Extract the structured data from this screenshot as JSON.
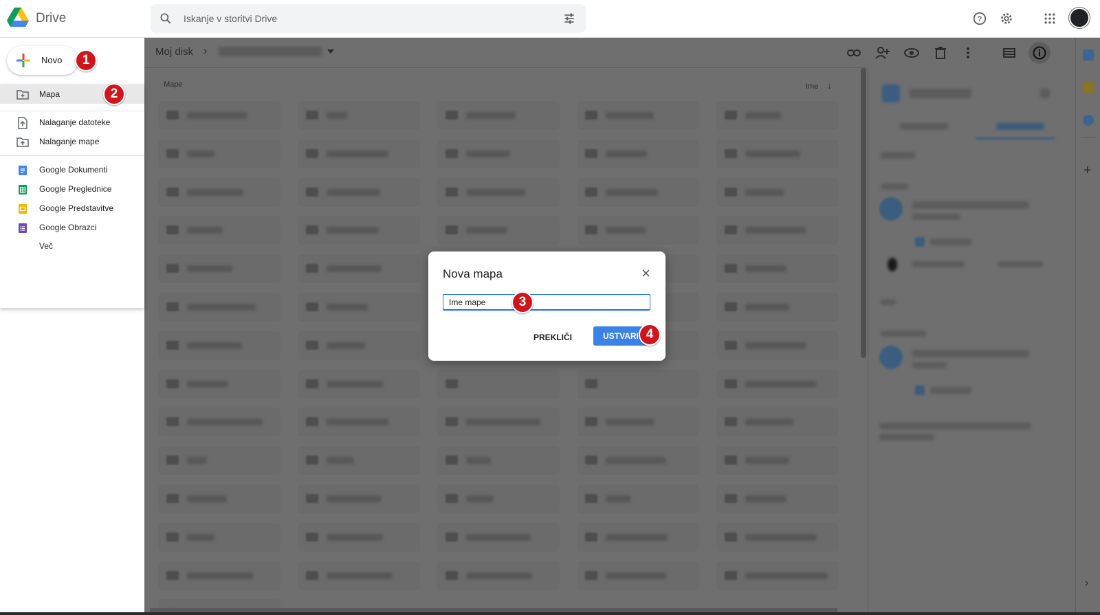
{
  "app": {
    "brand": "Drive"
  },
  "search": {
    "placeholder": "Iskanje v storitvi Drive"
  },
  "new_button": {
    "label": "Novo"
  },
  "new_menu": {
    "items": [
      {
        "label": "Mapa",
        "icon": "new-folder-icon"
      },
      {
        "label": "Nalaganje datoteke",
        "icon": "file-upload-icon"
      },
      {
        "label": "Nalaganje mape",
        "icon": "folder-upload-icon"
      },
      {
        "label": "Google Dokumenti",
        "icon": "google-docs-icon",
        "color": "#4285f4"
      },
      {
        "label": "Google Preglednice",
        "icon": "google-sheets-icon",
        "color": "#0f9d58"
      },
      {
        "label": "Google Predstavitve",
        "icon": "google-slides-icon",
        "color": "#f4b400"
      },
      {
        "label": "Google Obrazci",
        "icon": "google-forms-icon",
        "color": "#7248b9"
      },
      {
        "label": "Več",
        "icon": ""
      }
    ]
  },
  "breadcrumb": {
    "root": "Moj disk",
    "separator": "›"
  },
  "folders_section": {
    "label": "Mape",
    "sort_label": "Ime",
    "sort_icon": "arrow-down-icon"
  },
  "dialog": {
    "title": "Nova mapa",
    "input_value": "Ime mape",
    "cancel_label": "PREKLIČI",
    "create_label": "USTVARI"
  },
  "badges": [
    "1",
    "2",
    "3",
    "4"
  ],
  "colors": {
    "accent": "#1a73e8",
    "create_button": "#3b82e6",
    "badge": "#d2141c",
    "overlay": "#6f6f6f"
  }
}
